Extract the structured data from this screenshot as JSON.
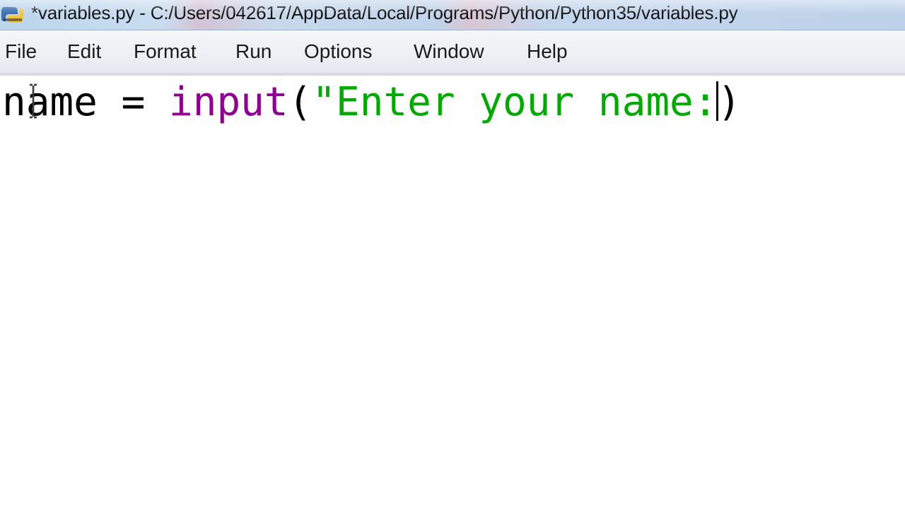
{
  "window": {
    "title": "*variables.py - C:/Users/042617/AppData/Local/Programs/Python/Python35/variables.py"
  },
  "menu": {
    "items": [
      "File",
      "Edit",
      "Format",
      "Run",
      "Options",
      "Window",
      "Help"
    ]
  },
  "editor": {
    "code": {
      "variable": "name",
      "operator": " = ",
      "function": "input",
      "open_paren": "(",
      "string": "\"Enter your name:",
      "close_paren": ")"
    }
  },
  "icons": {
    "app": "python-idle-icon",
    "cursor": "text-ibeam-cursor"
  },
  "colors": {
    "builtin": "#900090",
    "string": "#00aa00",
    "default_text": "#000000"
  }
}
